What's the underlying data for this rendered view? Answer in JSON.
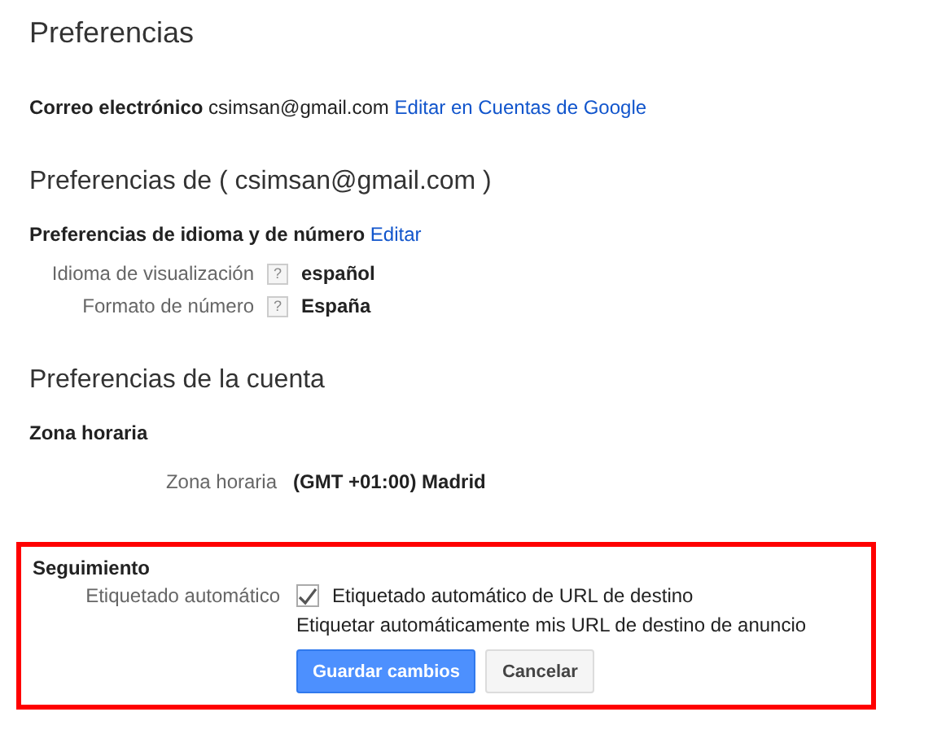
{
  "title": "Preferencias",
  "email": {
    "label": "Correo electrónico",
    "value": "csimsan@gmail.com",
    "link": "Editar en Cuentas de Google"
  },
  "user_section": {
    "title": "Preferencias de ( csimsan@gmail.com )",
    "subtitle": "Preferencias de idioma y de número",
    "edit_link": "Editar",
    "rows": [
      {
        "label": "Idioma de visualización",
        "help": "?",
        "value": "español"
      },
      {
        "label": "Formato de número",
        "help": "?",
        "value": "España"
      }
    ]
  },
  "account_section": {
    "title": "Preferencias de la cuenta",
    "subtitle": "Zona horaria",
    "rows": [
      {
        "label": "Zona horaria",
        "value": "(GMT +01:00) Madrid"
      }
    ]
  },
  "tracking": {
    "highlighted": true,
    "title": "Seguimiento",
    "label": "Etiquetado automático",
    "checkbox_label": "Etiquetado automático de URL de destino",
    "checked": true,
    "description": "Etiquetar automáticamente mis URL de destino de anuncio",
    "buttons": [
      {
        "label": "Guardar cambios",
        "kind": "primary"
      },
      {
        "label": "Cancelar",
        "kind": "secondary"
      }
    ]
  }
}
